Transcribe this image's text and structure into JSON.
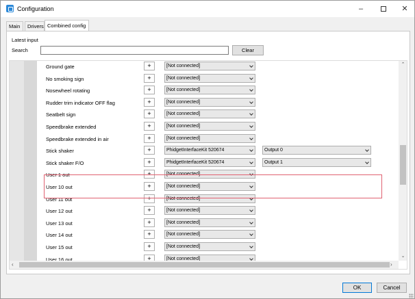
{
  "window": {
    "title": "Configuration"
  },
  "tabs": [
    {
      "label": "Main"
    },
    {
      "label": "Drivers"
    },
    {
      "label": "Combined config"
    }
  ],
  "latest_input_label": "Latest input",
  "search": {
    "label": "Search",
    "value": "",
    "placeholder": ""
  },
  "clear_label": "Clear",
  "rows": [
    {
      "label": "Ground gate",
      "plus": "+",
      "device": "[Not connected]"
    },
    {
      "label": "No smoking sign",
      "plus": "+",
      "device": "[Not connected]"
    },
    {
      "label": "Nosewheel rotating",
      "plus": "+",
      "device": "[Not connected]"
    },
    {
      "label": "Rudder trim indicator OFF flag",
      "plus": "+",
      "device": "[Not connected]"
    },
    {
      "label": "Seatbelt sign",
      "plus": "+",
      "device": "[Not connected]"
    },
    {
      "label": "Speedbrake extended",
      "plus": "+",
      "device": "[Not connected]"
    },
    {
      "label": "Speedbrake extended in air",
      "plus": "+",
      "device": "[Not connected]"
    },
    {
      "label": "Stick shaker",
      "plus": "+",
      "device": "PhidgetInterfaceKit 520674",
      "output": "Output 0"
    },
    {
      "label": "Stick shaker F/O",
      "plus": "+",
      "device": "PhidgetInterfaceKit 520674",
      "output": "Output 1"
    },
    {
      "label": "User 1 out",
      "plus": "+",
      "device": "[Not connected]"
    },
    {
      "label": "User 10 out",
      "plus": "+",
      "device": "[Not connected]"
    },
    {
      "label": "User 11 out",
      "plus": "+",
      "device": "[Not connected]"
    },
    {
      "label": "User 12 out",
      "plus": "+",
      "device": "[Not connected]"
    },
    {
      "label": "User 13 out",
      "plus": "+",
      "device": "[Not connected]"
    },
    {
      "label": "User 14 out",
      "plus": "+",
      "device": "[Not connected]"
    },
    {
      "label": "User 15 out",
      "plus": "+",
      "device": "[Not connected]"
    },
    {
      "label": "User 16 out",
      "plus": "+",
      "device": "[Not connected]"
    }
  ],
  "buttons": {
    "ok": "OK",
    "cancel": "Cancel"
  },
  "colors": {
    "highlight_border": "#e06070",
    "accent": "#0078d7",
    "app_icon": "#2b88d8"
  }
}
